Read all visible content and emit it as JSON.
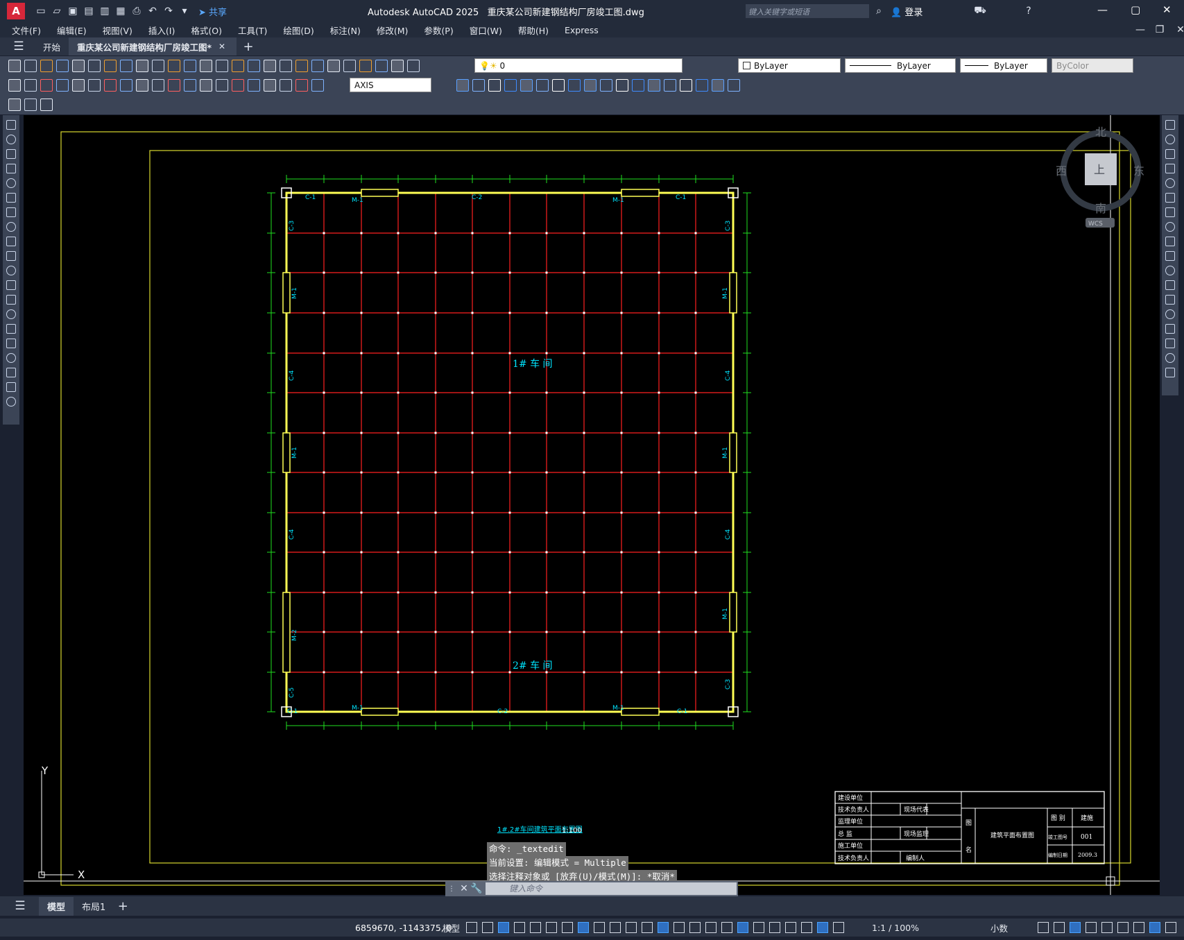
{
  "app": {
    "logo_letter": "A",
    "share_label": "共享",
    "title": "Autodesk AutoCAD 2025",
    "file_title": "重庆某公司新建钢结构厂房竣工图.dwg",
    "search_placeholder": "键入关键字或短语",
    "login_label": "登录"
  },
  "menu": [
    "文件(F)",
    "编辑(E)",
    "视图(V)",
    "插入(I)",
    "格式(O)",
    "工具(T)",
    "绘图(D)",
    "标注(N)",
    "修改(M)",
    "参数(P)",
    "窗口(W)",
    "帮助(H)",
    "Express"
  ],
  "tabs": {
    "start": "开始",
    "document": "重庆某公司新建钢结构厂房竣工图*"
  },
  "properties": {
    "layer": "0",
    "color": "ByLayer",
    "linetype": "ByLayer",
    "lineweight": "ByLayer",
    "plotstyle": "ByColor",
    "dimstyle": "AXIS"
  },
  "viewcube": {
    "north": "北",
    "south": "南",
    "east": "东",
    "west": "西",
    "top": "上",
    "wcs": "WCS"
  },
  "drawing": {
    "workshop1": "1# 车 间",
    "workshop2": "2# 车 间",
    "caption": "1#.2#车间建筑平面布置图",
    "scale": "1:100",
    "labels": {
      "c1": "C-1",
      "c2": "C-2",
      "c3": "C-3",
      "c4": "C-4",
      "c5": "C-5",
      "m1": "M-1",
      "m2": "M-2"
    },
    "titleblock": {
      "r1": "建设单位",
      "r2": "技术负责人",
      "r3": "监理单位",
      "r4": "总 监",
      "r5": "施工单位",
      "r6": "技术负责人",
      "v2": "现场代表",
      "v4": "现场监理",
      "v6": "编制人",
      "side1": "图",
      "side2": "名",
      "name": "建筑平面布置图",
      "k1": "图 别",
      "k2": "竣工图号",
      "k3": "编制日期",
      "d1": "建施",
      "d2": "001",
      "d3": "2009.3"
    }
  },
  "ucs": {
    "y": "Y",
    "x": "X"
  },
  "command": {
    "line1": "命令: _textedit",
    "line2": "当前设置: 编辑模式 = Multiple",
    "line3": "选择注释对象或 [放弃(U)/模式(M)]: *取消*",
    "input_placeholder": "键入命令"
  },
  "layouts": {
    "model": "模型",
    "layout1": "布局1"
  },
  "status": {
    "coords": "6859670, -1143375, 0",
    "model": "模型",
    "scale": "1:1 / 100%",
    "units": "小数"
  },
  "colors": {
    "grid": "#ff2020",
    "wall": "#ffff55",
    "dim": "#20e020",
    "text": "#00e5ff",
    "frame": "#d8d830"
  }
}
